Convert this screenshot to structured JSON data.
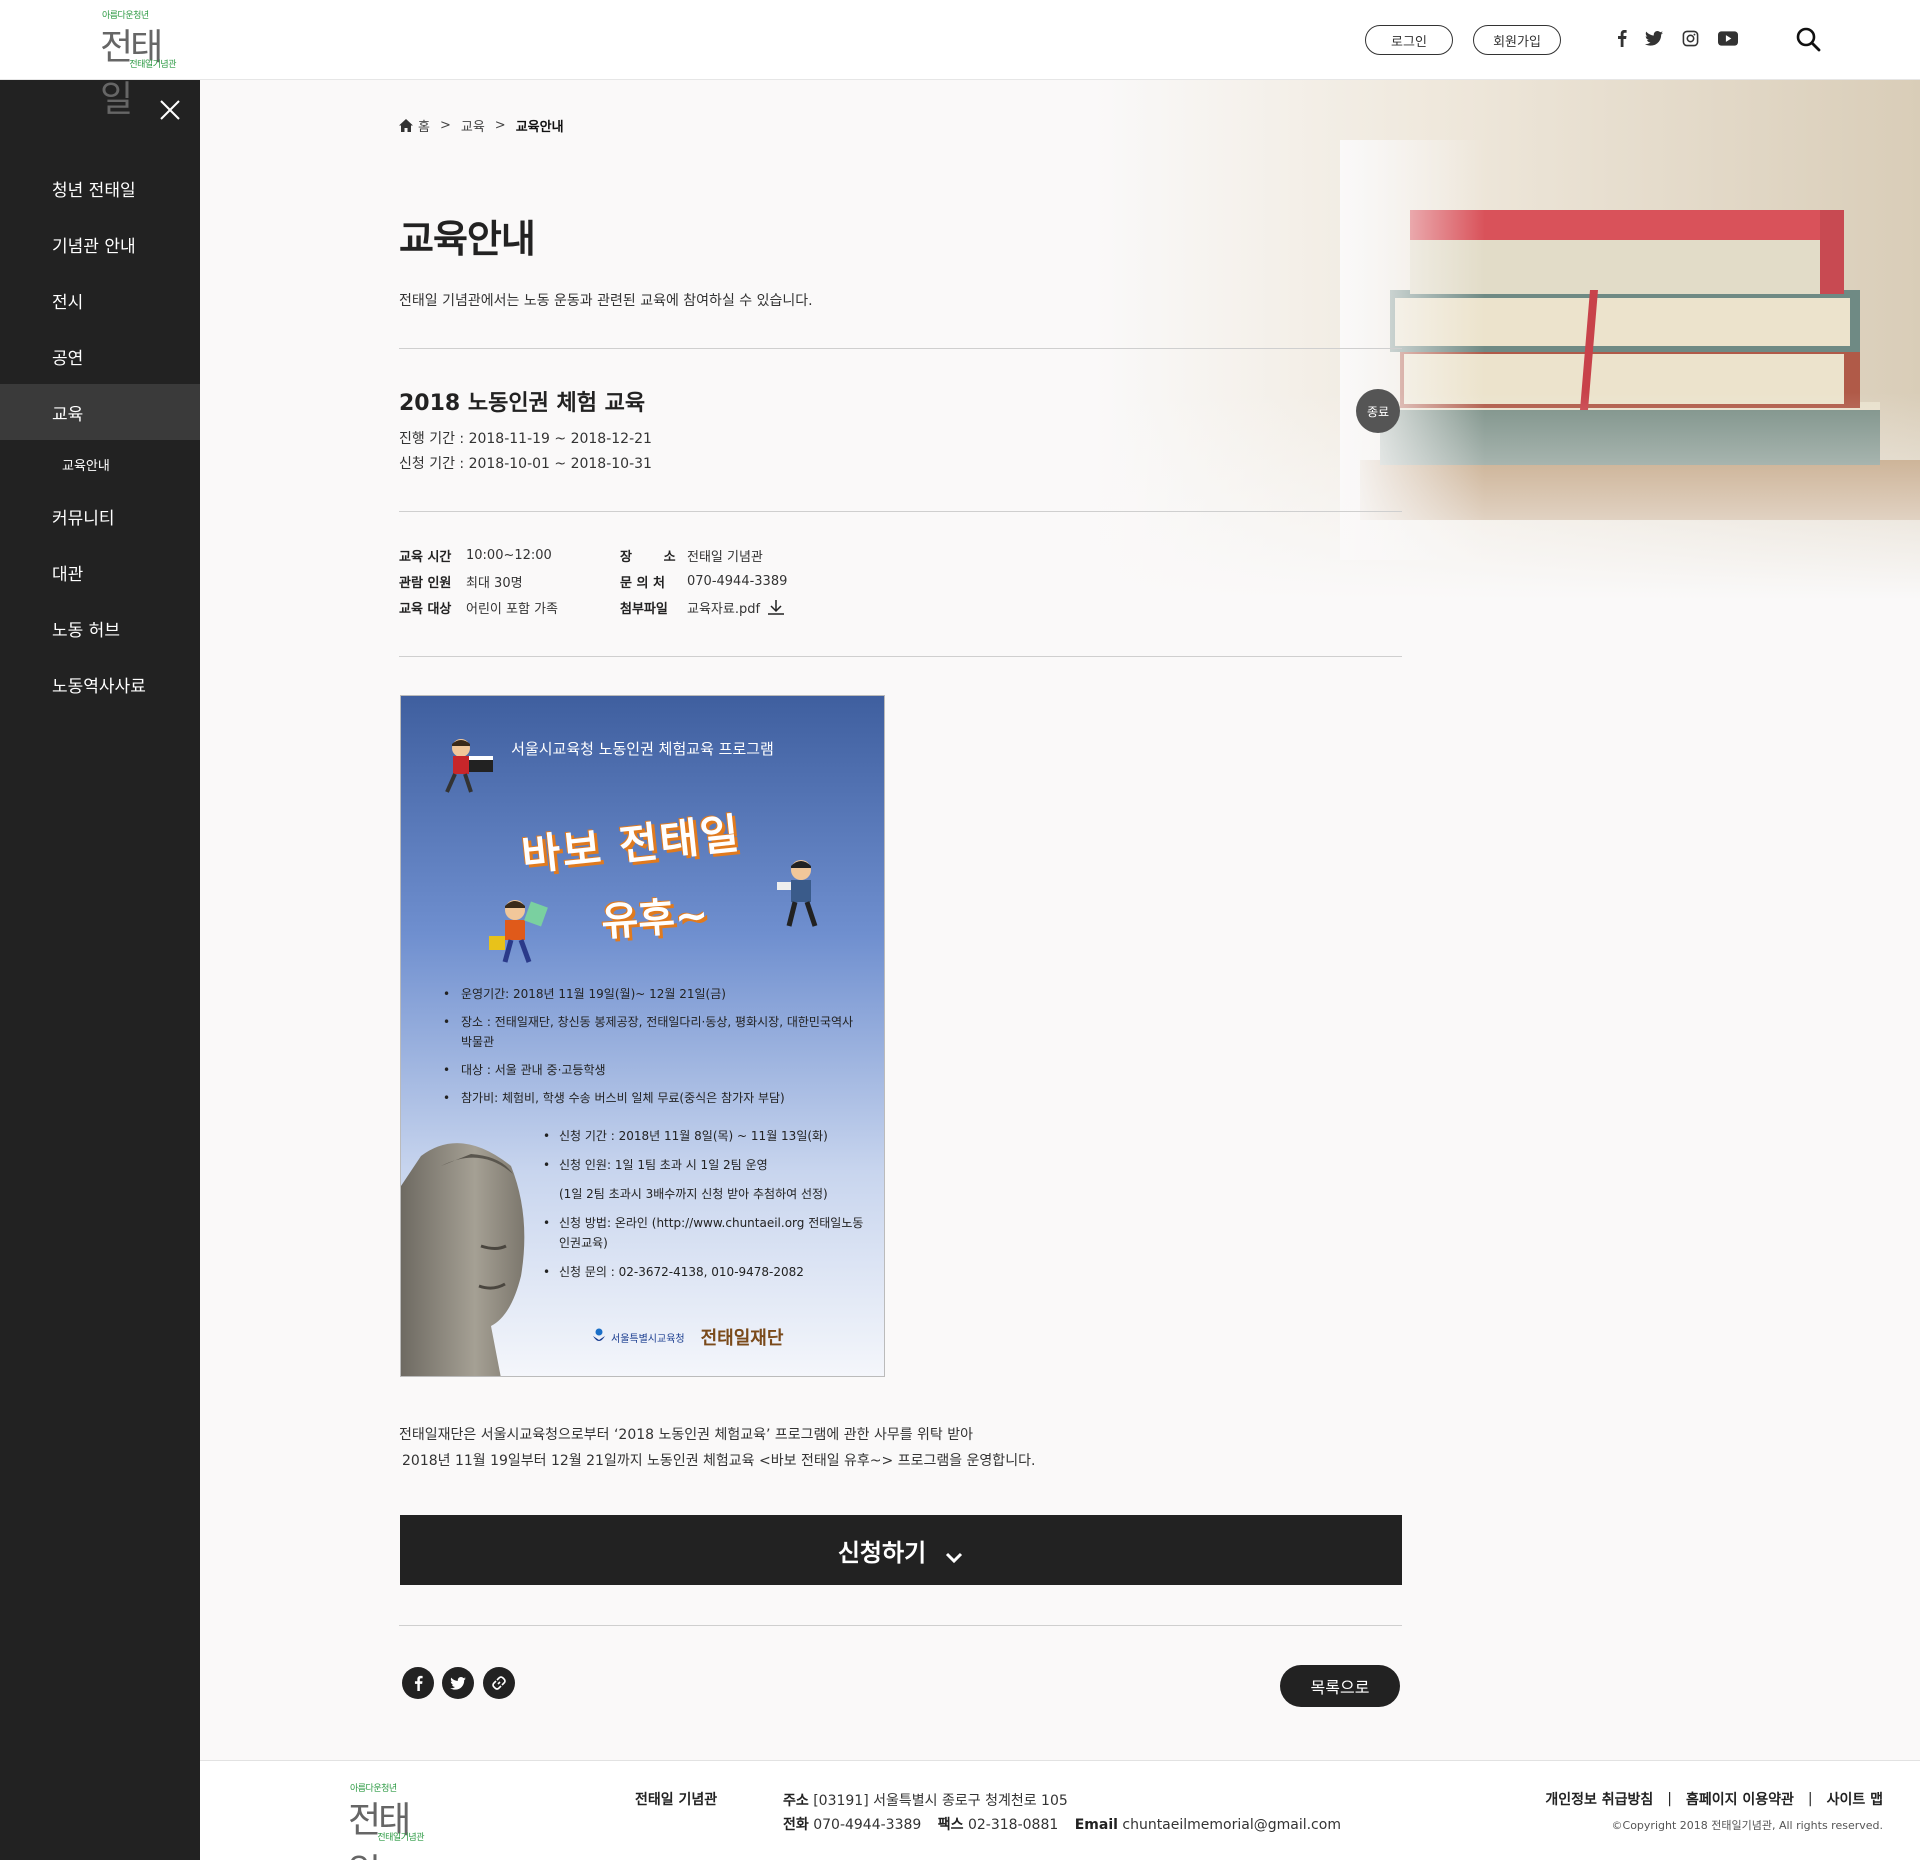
{
  "header": {
    "logo_top": "아름다운청년",
    "logo_main": "전태일",
    "logo_bottom": "전태일기념관",
    "login": "로그인",
    "join": "회원가입",
    "sns_icons": [
      "facebook-icon",
      "twitter-icon",
      "instagram-icon",
      "youtube-icon"
    ],
    "search_icon": "search-icon"
  },
  "sidebar": {
    "close_icon": "close-icon",
    "items": [
      {
        "label": "청년 전태일"
      },
      {
        "label": "기념관 안내"
      },
      {
        "label": "전시"
      },
      {
        "label": "공연"
      },
      {
        "label": "교육",
        "active": true
      },
      {
        "label": "교육안내",
        "sub": true
      },
      {
        "label": "커뮤니티"
      },
      {
        "label": "대관"
      },
      {
        "label": "노동 허브"
      },
      {
        "label": "노동역사사료"
      }
    ]
  },
  "breadcrumb": {
    "home": "홈",
    "sep": ">",
    "level1": "교육",
    "current": "교육안내"
  },
  "page": {
    "title": "교육안내",
    "desc": "전태일 기념관에서는 노동 운동과 관련된 교육에 참여하실 수 있습니다."
  },
  "event": {
    "title": "2018 노동인권 체험 교육",
    "period": "진행 기간 : 2018-11-19 ~ 2018-12-21",
    "apply_period": "신청 기간 : 2018-10-01 ~ 2018-10-31",
    "status": "종료"
  },
  "info": {
    "time_label": "교육 시간",
    "time": "10:00~12:00",
    "people_label": "관람 인원",
    "people": "최대 30명",
    "target_label": "교육 대상",
    "target": "어린이 포함 가족",
    "place_label": "장       소",
    "place": "전태일 기념관",
    "contact_label": "문 의 처",
    "contact": "070-4944-3389",
    "file_label": "첨부파일",
    "file": "교육자료.pdf"
  },
  "poster": {
    "heading": "서울시교육청 노동인권 체험교육 프로그램",
    "title1": "바보 전태일",
    "title2": "유후~",
    "items": [
      "운영기간: 2018년 11월 19일(월)~ 12월 21일(금)",
      "장소 : 전태일재단, 창신동 봉제공장, 전태일다리·동상, 평화시장, 대한민국역사박물관",
      "대상 : 서울 관내 중·고등학생",
      "참가비: 체험비, 학생 수송 버스비 일체 무료(중식은 참가자 부담)"
    ],
    "subitems": [
      "신청 기간 : 2018년 11월 8일(목) ~ 11월 13일(화)",
      "신청 인원: 1일 1팀 초과 시 1일 2팀 운영",
      "(1일 2팀 초과시 3배수까지 신청 받아 추첨하여 선정)",
      "신청 방법: 온라인 (http://www.chuntaeil.org 전태일노동인권교육)",
      "신청 문의 : 02-3672-4138, 010-9478-2082"
    ],
    "logo1": "서울특별시교육청",
    "logo2": "전태일재단"
  },
  "body": {
    "line1": "전태일재단은 서울시교육청으로부터 ‘2018 노동인권 체험교육’ 프로그램에 관한 사무를 위탁 받아",
    "line2": "2018년 11월 19일부터 12월 21일까지 노동인권 체험교육 <바보 전태일 유후~> 프로그램을 운영합니다."
  },
  "actions": {
    "apply": "신청하기",
    "list": "목록으로",
    "share_icons": [
      "facebook-icon",
      "twitter-icon",
      "link-icon"
    ]
  },
  "footer": {
    "org": "전태일 기념관",
    "addr_label": "주소",
    "addr": "[03191] 서울특별시 종로구 청계천로 105",
    "tel_label": "전화",
    "tel": "070-4944-3389",
    "fax_label": "팩스",
    "fax": "02-318-0881",
    "email_label": "Email",
    "email": "chuntaeilmemorial@gmail.com",
    "privacy": "개인정보 취급방침",
    "terms": "홈페이지 이용약관",
    "sitemap": "사이트 맵",
    "sep": "|",
    "copyright": "©Copyright 2018 전태일기념관, All rights reserved."
  }
}
